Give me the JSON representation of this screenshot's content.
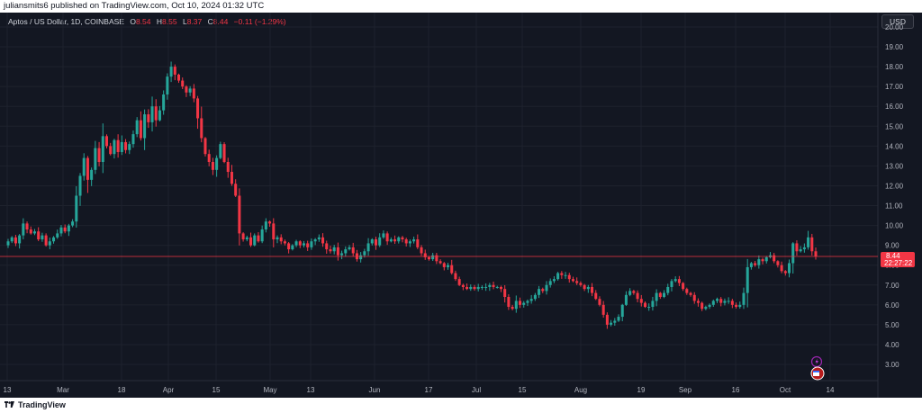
{
  "header": {
    "published": "juliansmits6 published on TradingView.com, Oct 10, 2024 01:32 UTC"
  },
  "legend": {
    "symbol": "Aptos / US Dollar, 1D, COINBASE",
    "o_label": "O",
    "o_value": "8.54",
    "h_label": "H",
    "h_value": "8.55",
    "l_label": "L",
    "l_value": "8.37",
    "c_label": "C",
    "c_value": "8.44",
    "change": "−0.11 (−1.29%)"
  },
  "currency_button": "USD",
  "price_tag": {
    "value": "8.44",
    "countdown": "22:27:22"
  },
  "footer": {
    "brand": "TradingView"
  },
  "colors": {
    "up": "#26a69a",
    "down": "#f23645",
    "background": "#131722",
    "grid": "#1e222d"
  },
  "chart_data": {
    "type": "candlestick",
    "y_ticks": [
      "3.00",
      "4.00",
      "5.00",
      "6.00",
      "7.00",
      "8.00",
      "9.00",
      "10.00",
      "11.00",
      "12.00",
      "13.00",
      "14.00",
      "15.00",
      "16.00",
      "17.00",
      "18.00",
      "19.00",
      "20.00"
    ],
    "ylim": [
      2.7,
      20.4
    ],
    "x_ticks": [
      "13",
      "Mar",
      "18",
      "Apr",
      "15",
      "May",
      "13",
      "Jun",
      "17",
      "Jul",
      "15",
      "Aug",
      "19",
      "Sep",
      "16",
      "Oct",
      "14"
    ],
    "last_price": 8.44,
    "closes": [
      9.2,
      9.4,
      9.1,
      9.5,
      10.1,
      9.8,
      9.6,
      9.7,
      9.3,
      9.5,
      9.0,
      9.2,
      9.4,
      9.6,
      9.9,
      9.7,
      10.0,
      10.2,
      11.5,
      12.5,
      13.4,
      12.3,
      12.8,
      13.9,
      13.2,
      14.5,
      14.0,
      13.6,
      14.3,
      13.7,
      14.2,
      13.8,
      14.1,
      14.6,
      15.3,
      14.4,
      15.6,
      15.2,
      16.0,
      15.3,
      15.8,
      16.6,
      17.5,
      18.0,
      17.6,
      17.3,
      17.0,
      16.7,
      16.9,
      16.4,
      15.4,
      14.4,
      13.6,
      13.2,
      12.8,
      13.4,
      14.1,
      13.2,
      12.7,
      12.1,
      11.5,
      9.6,
      9.3,
      9.4,
      9.0,
      9.5,
      9.2,
      9.8,
      10.2,
      10.1,
      9.3,
      9.4,
      9.2,
      9.1,
      8.8,
      9.0,
      9.2,
      9.0,
      9.1,
      8.9,
      9.2,
      9.3,
      9.4,
      9.1,
      8.8,
      8.7,
      8.9,
      8.5,
      8.6,
      8.8,
      8.9,
      8.6,
      8.3,
      8.5,
      8.7,
      9.1,
      9.3,
      9.0,
      9.4,
      9.6,
      9.2,
      9.3,
      9.2,
      9.4,
      9.3,
      9.1,
      9.2,
      9.3,
      8.9,
      8.6,
      8.4,
      8.3,
      8.5,
      8.2,
      8.1,
      7.9,
      8.0,
      7.6,
      7.3,
      7.0,
      6.9,
      6.8,
      6.9,
      6.8,
      6.9,
      6.9,
      6.9,
      7.0,
      6.9,
      6.9,
      6.8,
      6.4,
      5.9,
      5.8,
      6.2,
      6.0,
      6.1,
      6.2,
      6.3,
      6.5,
      6.8,
      6.7,
      7.0,
      7.2,
      7.3,
      7.6,
      7.5,
      7.5,
      7.3,
      7.2,
      7.1,
      7.0,
      6.8,
      6.9,
      6.6,
      6.3,
      6.0,
      5.5,
      5.0,
      5.1,
      5.2,
      5.4,
      6.0,
      6.5,
      6.7,
      6.6,
      6.3,
      6.1,
      5.9,
      5.9,
      6.2,
      6.6,
      6.4,
      6.6,
      6.9,
      7.2,
      7.3,
      7.1,
      6.8,
      6.6,
      6.5,
      6.2,
      6.1,
      5.8,
      5.9,
      6.0,
      6.2,
      6.3,
      6.1,
      6.2,
      6.2,
      6.0,
      5.9,
      6.0,
      6.6,
      7.9,
      8.1,
      8.0,
      8.3,
      8.2,
      8.4,
      8.5,
      8.2,
      8.0,
      7.7,
      7.6,
      8.1,
      9.1,
      8.7,
      8.8,
      8.9,
      9.4,
      8.7,
      8.44
    ]
  }
}
